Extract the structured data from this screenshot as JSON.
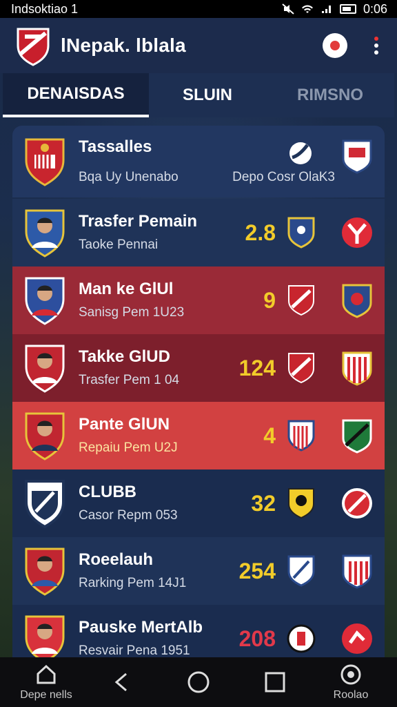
{
  "status": {
    "left_text": "Indsoktiao 1",
    "time": "0:06"
  },
  "app": {
    "title": "lNepak. lblala"
  },
  "tabs": [
    {
      "label": "DENAISDAS",
      "active": true
    },
    {
      "label": "SLUIN",
      "active": false
    },
    {
      "label": "RIMSNO",
      "active": false
    }
  ],
  "header_row": {
    "name": "Tassalles",
    "sub": "Bqa Uy Unenabo",
    "right_text": "Depo Cosr OlaK3"
  },
  "rows": [
    {
      "name": "Trasfer Pemain",
      "sub": "Taoke Pennai",
      "value": "2.8",
      "value_color": "#f2cc2a"
    },
    {
      "name": "Man ke GlUl",
      "sub": "Sanisg Pem 1U23",
      "value": "9",
      "value_color": "#f2cc2a"
    },
    {
      "name": "Takke GlUD",
      "sub": "Trasfer Pem 1 04",
      "value": "124",
      "value_color": "#f2cc2a"
    },
    {
      "name": "Pante GlUN",
      "sub": "Repaiu Pem U2J",
      "value": "4",
      "value_color": "#f2cc2a"
    },
    {
      "name": "CLUBB",
      "sub": "Casor Repm 053",
      "value": "32",
      "value_color": "#f2cc2a"
    },
    {
      "name": "Roeelauh",
      "sub": "Rarking Pem 14J1",
      "value": "254",
      "value_color": "#f2cc2a"
    },
    {
      "name": "Pauske MertAlb",
      "sub": "Resvair Pena 1951",
      "value": "208",
      "value_color": "#e2394a"
    }
  ],
  "nav": [
    {
      "label": "Depe nells",
      "icon": "home-icon"
    },
    {
      "label": "",
      "icon": "back-icon"
    },
    {
      "label": "",
      "icon": "circle-home-icon"
    },
    {
      "label": "",
      "icon": "square-recents-icon"
    },
    {
      "label": "Roolao",
      "icon": "settings-icon"
    }
  ],
  "colors": {
    "accent_yellow": "#f2cc2a",
    "accent_red": "#e2394a",
    "appbar": "#1c2b4c",
    "row_red": "#9a2a37"
  }
}
